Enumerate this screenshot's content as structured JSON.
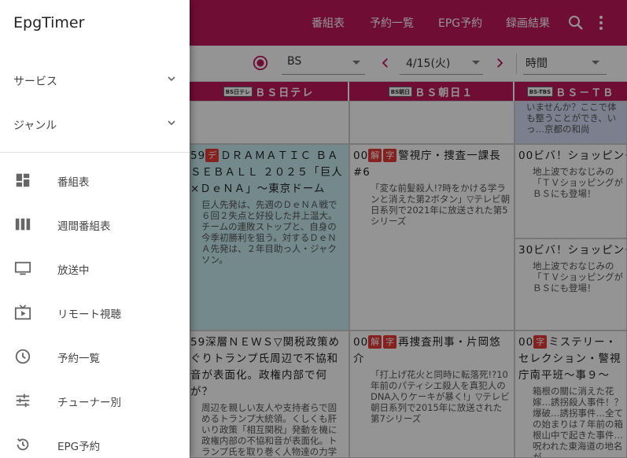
{
  "appbar": {
    "nav": [
      "番組表",
      "予約一覧",
      "EPG予約",
      "録画結果"
    ]
  },
  "toolbar": {
    "network": "BS",
    "date": "4/15(火)",
    "mode": "時間"
  },
  "channels": [
    {
      "logo": "BS日テレ",
      "name": "ＢＳ日テレ"
    },
    {
      "logo": "BS朝日",
      "name": "ＢＳ朝日１"
    },
    {
      "logo": "BS-TBS",
      "name": "ＢＳ－ＴＢ"
    }
  ],
  "programs": {
    "p1": {
      "time": "59",
      "badges": [
        "デ"
      ],
      "title": "ＤＲＡＭＡＴＩＣ ＢＡＳＥＢＡＬＬ ２０２５「巨人×ＤｅＮＡ」～東京ドーム",
      "desc": "巨人先発は、先週のＤｅＮＡ戦で６回２失点と好投した井上温大。チームの連敗ストップと、自身の今季初勝利を狙う。対するＤｅＮＡ先発は、２年目助っ人・ジャクソン。"
    },
    "p2": {
      "time": "00",
      "badges": [
        "解",
        "字"
      ],
      "title": "警視庁・捜査一課長 #6",
      "desc": "「変な前髪殺人!?時をかける学ランと消えた第2ボタン」▽テレビ朝日系列で2021年に放送された第5シリーズ"
    },
    "p3": {
      "time": "00",
      "badges": [],
      "title": "ビバ！ショッピング",
      "desc": "地上波でおなじみの「ＴＶショッピングがＢＳにも登場！"
    },
    "p4": {
      "time": "30",
      "badges": [],
      "title": "ビバ！ショッピング",
      "desc": "地上波でおなじみの「ＴＶショッピングがＢＳにも登場！"
    },
    "p5": {
      "time": "59",
      "badges": [],
      "title": "深層ＮＥＷＳ▽関税政策めぐりトランプ氏周辺で不協和音が表面化。政権内部で何が？",
      "desc": "周辺を親しい友人や支持者らで固めるトランプ大統領。くしくも肝いり政策「相互関税」発動を機に政権内部の不協和音が表面化。トランプ氏を取り巻く人物達の力学を読み解く"
    },
    "p6": {
      "time": "00",
      "badges": [
        "解",
        "字"
      ],
      "title": "再捜査刑事・片岡悠介",
      "desc": "「打上げ花火と同時に転落死!?10年前のパティシエ殺人を真犯人のDNA入りケーキが暴く!」▽テレビ朝日系列で2015年に放送された第7シリーズ"
    },
    "p7": {
      "time": "00",
      "badges": [
        "字"
      ],
      "title": "ミステリー・セレクション・警視庁南平班～事９～",
      "desc": "箱根の關に消えた花嫁…誘拐殺人事件！？爆破…誘拐事件…全ての始まりは７年前の箱根山中で起きた事件…呪われた東海道の地名が…"
    },
    "p8": {
      "top_text": "いませんか？ここで体も整うことができ、いっ…京都の和尚"
    }
  },
  "drawer": {
    "title": "EpgTimer",
    "expanders": [
      "サービス",
      "ジャンル"
    ],
    "items": [
      {
        "icon": "grid-icon",
        "label": "番組表"
      },
      {
        "icon": "weekly-columns-icon",
        "label": "週間番組表"
      },
      {
        "icon": "tv-icon",
        "label": "放送中"
      },
      {
        "icon": "remote-play-icon",
        "label": "リモート視聴"
      },
      {
        "icon": "clock-icon",
        "label": "予約一覧"
      },
      {
        "icon": "tune-icon",
        "label": "チューナー別"
      },
      {
        "icon": "history-icon",
        "label": "EPG予約"
      }
    ]
  },
  "colors": {
    "primary": "#c2185b",
    "badge": "#e53935",
    "sports_bg": "#c8ecf0"
  }
}
